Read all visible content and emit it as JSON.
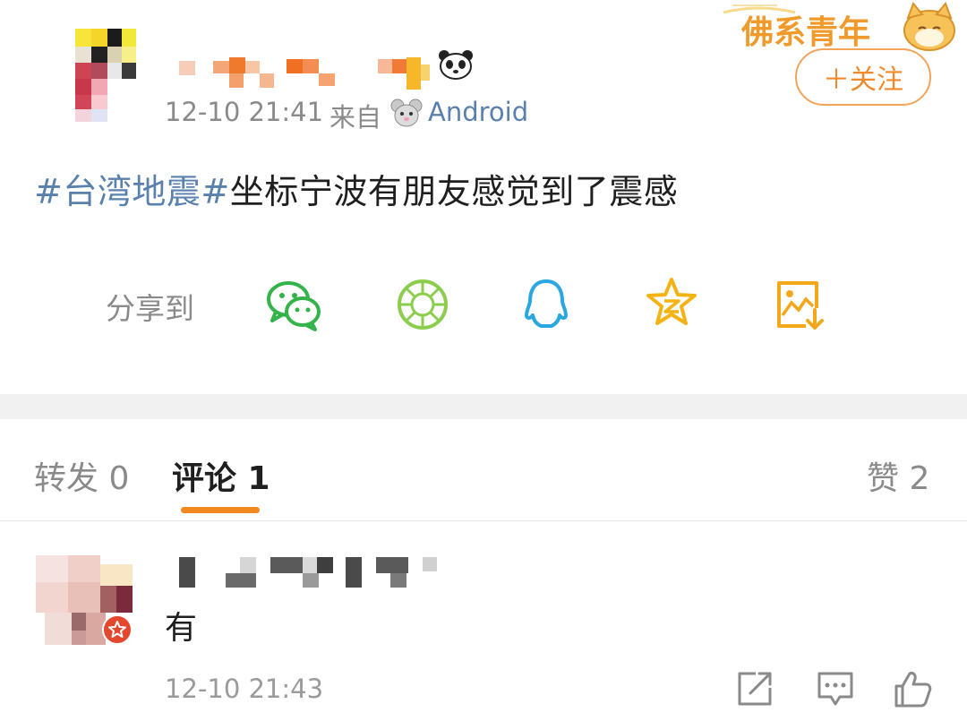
{
  "post": {
    "time": "12-10 21:41",
    "source_prefix": "来自",
    "source_device": "Android",
    "topic": "#台湾地震#",
    "text": "坐标宁波有朋友感觉到了震感",
    "follow_label": "＋关注",
    "banner_text": "佛系青年"
  },
  "share": {
    "label": "分享到",
    "targets": [
      "wechat-icon",
      "moments-icon",
      "qq-icon",
      "qzone-icon",
      "save-image-icon"
    ]
  },
  "tabs": {
    "repost": "转发 0",
    "comments": "评论 1",
    "likes": "赞 2"
  },
  "comment": {
    "text": "有",
    "time": "12-10 21:43",
    "actions": [
      "repost-icon",
      "reply-icon",
      "like-icon"
    ]
  },
  "colors": {
    "accent": "#f0881f",
    "link": "#5a80ad",
    "wechat": "#33b34a",
    "moments": "#8ccd4d",
    "qq": "#2aa6e0",
    "qzone": "#f3b315",
    "save": "#f3a81c"
  }
}
